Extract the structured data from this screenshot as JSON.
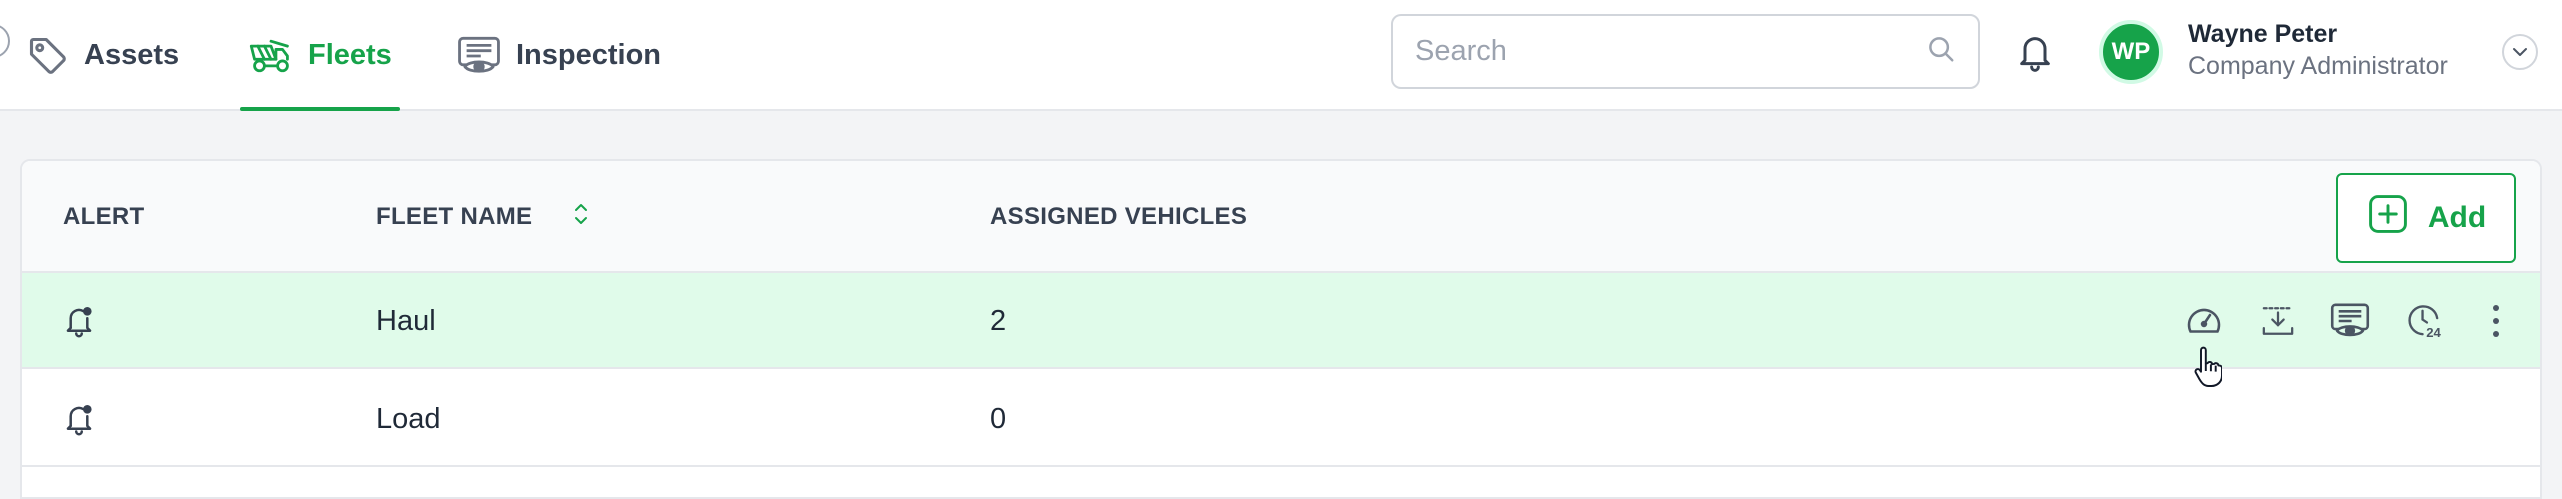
{
  "nav": {
    "tabs": [
      {
        "label": "Assets",
        "icon": "tag-icon"
      },
      {
        "label": "Fleets",
        "icon": "truck-fleet-icon",
        "active": true
      },
      {
        "label": "Inspection",
        "icon": "inspection-icon"
      }
    ]
  },
  "search": {
    "placeholder": "Search",
    "value": ""
  },
  "user": {
    "initials": "WP",
    "name": "Wayne Peter",
    "role": "Company Administrator"
  },
  "table": {
    "columns": [
      "ALERT",
      "FLEET NAME",
      "ASSIGNED VEHICLES"
    ],
    "add_label": "Add",
    "rows": [
      {
        "name": "Haul",
        "vehicles": "2",
        "highlighted": true
      },
      {
        "name": "Load",
        "vehicles": "0",
        "highlighted": false
      }
    ],
    "row_actions": [
      "speedometer-icon",
      "download-icon",
      "inspection-icon",
      "history-24-icon",
      "more-vertical-icon"
    ]
  },
  "colors": {
    "accent": "#16a34a",
    "row_highlight": "#e0fbea",
    "text": "#1f2937",
    "muted": "#6b7280"
  }
}
